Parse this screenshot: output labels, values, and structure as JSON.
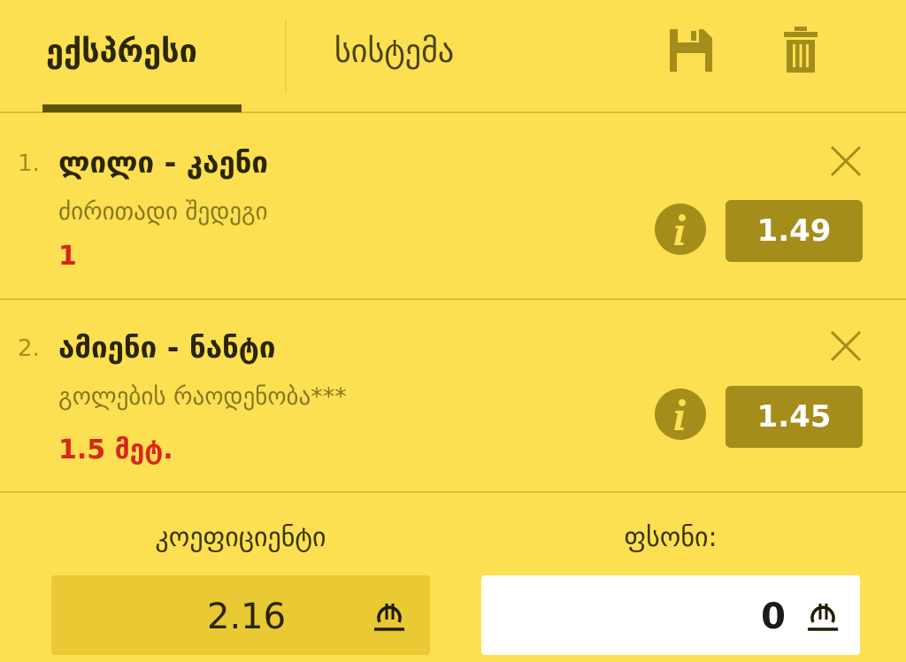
{
  "tabs": [
    {
      "label": "ექსპრესი",
      "active": true
    },
    {
      "label": "სისტემა",
      "active": false
    }
  ],
  "toolbar": {
    "save_icon": "save-icon",
    "trash_icon": "trash-icon"
  },
  "bets": [
    {
      "index": "1.",
      "title": "ლილი - კაენი",
      "market": "ძირითადი შედეგი",
      "outcome": "1",
      "odd": "1.49"
    },
    {
      "index": "2.",
      "title": "ამიენი - ნანტი",
      "market": "გოლების რაოდენობა***",
      "outcome": "1.5 მეტ.",
      "odd": "1.45"
    }
  ],
  "summary": {
    "coef_label": "კოეფიციენტი",
    "coef_value": "2.16",
    "stake_label": "ფსონი:",
    "stake_value": "0",
    "currency_icon": "lari-icon"
  },
  "colors": {
    "background": "#fde052",
    "odd_box": "#a48d1a",
    "outcome_red": "#d6271a",
    "active_tab_underline": "#5e5209"
  }
}
